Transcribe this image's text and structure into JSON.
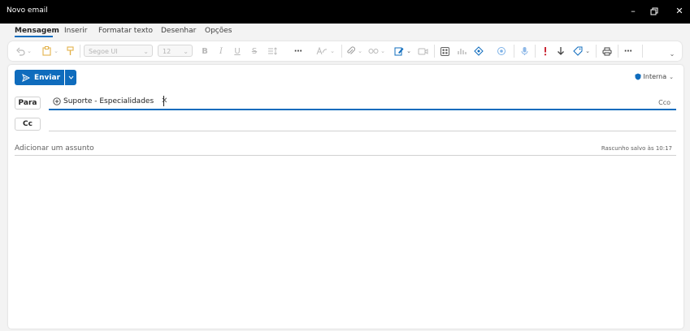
{
  "window": {
    "title": "Novo email"
  },
  "menu": {
    "tabs": [
      "Mensagem",
      "Inserir",
      "Formatar texto",
      "Desenhar",
      "Opções"
    ]
  },
  "ribbon": {
    "font_name": "Segoe UI",
    "font_size": "12"
  },
  "compose": {
    "send_label": "Enviar",
    "sensitivity": "Interna",
    "to_label": "Para",
    "cc_label": "Cc",
    "bcc_label": "Cco",
    "recipient": "Suporte - Especialidades",
    "subject_placeholder": "Adicionar um assunto",
    "draft_status": "Rascunho salvo às 10:17"
  },
  "colors": {
    "accent": "#0f6cbd",
    "titlebar": "#000000",
    "background": "#f3f3f3",
    "flag_red": "#c50f1f"
  }
}
